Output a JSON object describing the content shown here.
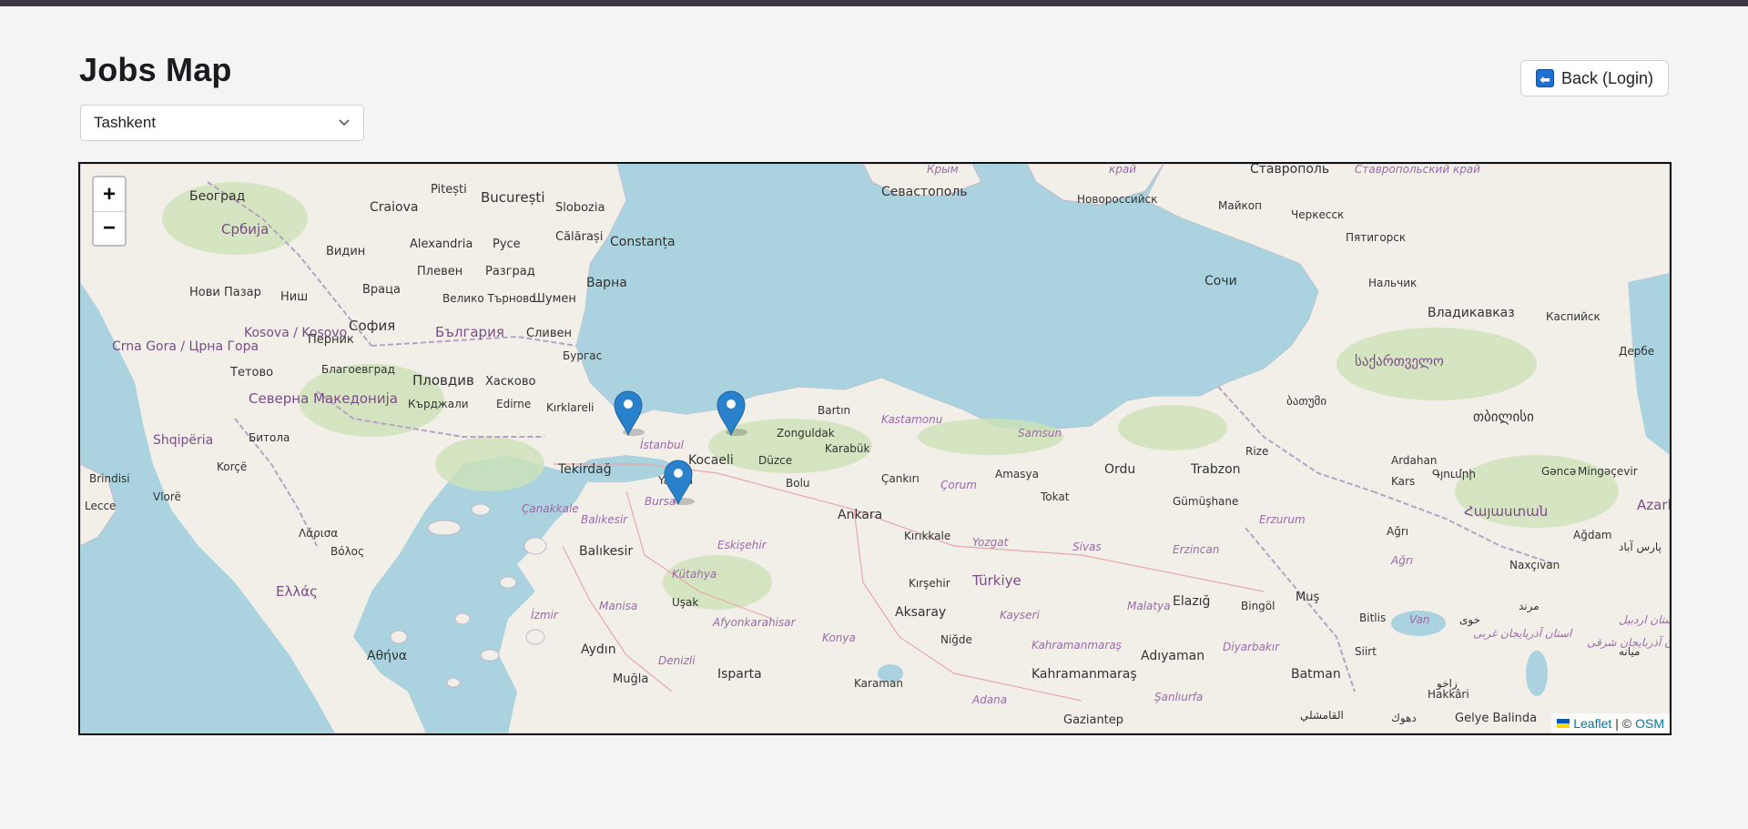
{
  "page": {
    "title": "Jobs Map",
    "back_button_label": "Back (Login)",
    "back_icon_glyph": "⬅"
  },
  "city_select": {
    "selected": "Tashkent"
  },
  "map": {
    "zoom_in_label": "+",
    "zoom_out_label": "−",
    "attribution": {
      "leaflet_label": "Leaflet",
      "separator": "| ©",
      "osm_label": "OSM"
    },
    "colors": {
      "sea": "#aad3df",
      "land": "#f2efe9",
      "forest": "#cde2b6",
      "marker": "#2a81cb",
      "border": "#b7a2c4"
    },
    "markers": [
      {
        "name": "marker-istanbul-west"
      },
      {
        "name": "marker-istanbul-east"
      },
      {
        "name": "marker-yalova"
      }
    ],
    "labels": {
      "beograd": "Београд",
      "srbija": "Србија",
      "craiova": "Craiova",
      "bucuresti": "București",
      "pitesti": "Pitești",
      "slobozia": "Slobozia",
      "alexandria": "Alexandria",
      "ruse": "Русе",
      "calarasi": "Călărași",
      "constanta": "Constanța",
      "vidin": "Видин",
      "pleven": "Плевен",
      "razgrad": "Разград",
      "vratsa": "Враца",
      "veliko": "Велико Търново",
      "shumen": "Шумен",
      "varna": "Варна",
      "sofia": "София",
      "bulgaria": "България",
      "sliven": "Сливен",
      "burgas": "Бургас",
      "plovdiv": "Пловдив",
      "haskovo": "Хасково",
      "kardzhali": "Кърджали",
      "edirne": "Edirne",
      "kirklareli": "Kırklareli",
      "blagoevgrad": "Благоевград",
      "pernik": "Перник",
      "novi_pazar": "Нови Пазар",
      "nis": "Ниш",
      "kosova": "Kosova / Kosovo",
      "crna_gora": "Crna Gora / Црна Гора",
      "tetovo": "Тетово",
      "severna": "Северна Македонија",
      "shqiperia": "Shqipëria",
      "bitola": "Битола",
      "korce": "Korçë",
      "vlore": "Vlorë",
      "brindisi": "Brindisi",
      "lecce": "Lecce",
      "larisa": "Λάρισα",
      "volos": "Βόλος",
      "ellas": "Ελλάς",
      "athina": "Αθήνα",
      "tekirdag": "Tekirdağ",
      "istanbul": "İstanbul",
      "kocaeli": "Kocaeli",
      "yalova": "Yalova",
      "bursa": "Bursa",
      "canakkale": "Çanakkale",
      "balikesir": "Balıkesir",
      "balikesir2": "Balıkesir",
      "manisa": "Manisa",
      "izmir": "İzmir",
      "aydin": "Aydın",
      "mugla": "Muğla",
      "denizli": "Denizli",
      "usak": "Uşak",
      "kutahya": "Kütahya",
      "eskisehir": "Eskişehir",
      "afyon": "Afyonkarahisar",
      "isparta": "Isparta",
      "duzce": "Düzce",
      "bolu": "Bolu",
      "zonguldak": "Zonguldak",
      "bartin": "Bartın",
      "karabuk": "Karabük",
      "kastamonu": "Kastamonu",
      "cankiri": "Çankırı",
      "ankara": "Ankara",
      "kirikkale": "Kırıkkale",
      "corum": "Çorum",
      "amasya": "Amasya",
      "samsun": "Samsun",
      "tokat": "Tokat",
      "ordu": "Ordu",
      "trabzon": "Trabzon",
      "rize": "Rize",
      "gumushane": "Gümüşhane",
      "yozgat": "Yozgat",
      "sivas": "Sivas",
      "turkiye": "Türkiye",
      "kirsehir": "Kırşehir",
      "aksaray": "Aksaray",
      "nigde": "Niğde",
      "kayseri": "Kayseri",
      "konya": "Konya",
      "karaman": "Karaman",
      "adana": "Adana",
      "kahramanmaras": "Kahramanmaraş",
      "kahramanmaras2": "Kahramanmaraş",
      "gaziantep": "Gaziantep",
      "sanliurfa": "Şanlıurfa",
      "adiyaman": "Adıyaman",
      "malatya": "Malatya",
      "elazig": "Elazığ",
      "erzincan": "Erzincan",
      "erzurum": "Erzurum",
      "bingol": "Bingöl",
      "mus": "Muş",
      "diyarbakir": "Diyarbakır",
      "batman": "Batman",
      "siirt": "Siirt",
      "bitlis": "Bitlis",
      "van": "Van",
      "agri": "Ağrı",
      "agri2": "Ağrı",
      "kars": "Kars",
      "ardahan": "Ardahan",
      "hakkari": "Hakkâri",
      "gelye": "Gelye Balinda",
      "sevastopol": "Севастополь",
      "krym": "Крым",
      "novorossiysk": "Новороссийск",
      "krai": "край",
      "stavropol": "Ставрополь",
      "stavropol_krai": "Ставропольский край",
      "maykop": "Майкоп",
      "cherkessk": "Черкесск",
      "pyatigorsk": "Пятигорск",
      "sochi": "Сочи",
      "nalchik": "Нальчик",
      "vladikavkaz": "Владикавказ",
      "kaspiysk": "Каспийск",
      "derbent": "Дербе",
      "batumi": "ბათუმი",
      "georgia": "საქართველო",
      "tbilisi": "თბილისი",
      "gyumri": "Գյումրի",
      "hayastan": "Հայաստան",
      "ganca": "Gəncə",
      "mingacevir": "Mingəçevir",
      "agdam": "Ağdam",
      "naxcivan": "Naxçıvan",
      "azar": "Azarb",
      "pars_abad": "پارس آباد",
      "marand": "مرند",
      "khoy": "خوی",
      "tabriz_region": "استان آذربایجان غربی",
      "miyaneh": "میانه",
      "ardabil": "استان اردبیل",
      "east_azar": "استان آذربایجان شرقی",
      "dahuk": "دهوك",
      "zakho": "زاخو",
      "qamishli": "القامشلي"
    }
  }
}
